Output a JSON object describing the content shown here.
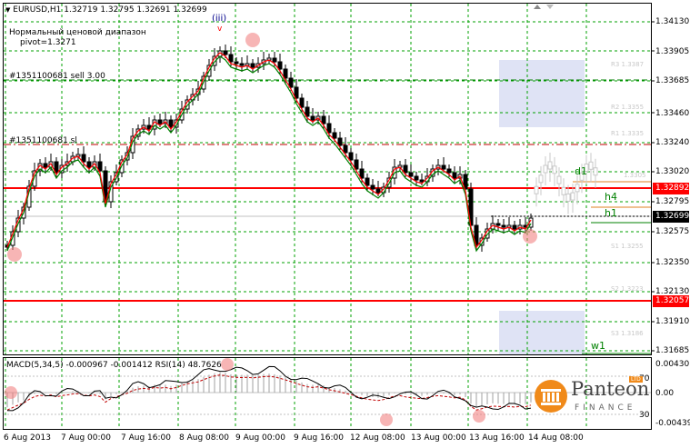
{
  "header": {
    "symbol": "EURUSD,H1",
    "ohlc": "1.32719 1.32795 1.32691 1.32699",
    "indicator_title": "Нормальный ценовой диапазон",
    "pivot": "pivot=1.3271",
    "wave_label": "(iii)",
    "wave_sub": "v"
  },
  "order_lines": {
    "sell": "#1351100681 sell 3.00",
    "sl": "#1351100681 sl"
  },
  "price_axis": [
    "1.34130",
    "1.33905",
    "1.33685",
    "1.33460",
    "1.33240",
    "1.33020",
    "1.32795",
    "1.32575",
    "1.32350",
    "1.32130",
    "1.31910",
    "1.31685"
  ],
  "price_boxes": [
    {
      "value": "1.32892",
      "color": "#ff0000"
    },
    {
      "value": "1.32699",
      "color": "#000000"
    },
    {
      "value": "1.32057",
      "color": "#ff0000"
    }
  ],
  "level_labels": {
    "r3": "R3 1.3387",
    "r2": "R2 1.3355",
    "r1": "R1 1.3335",
    "s1": "S1 1.3255",
    "s2": "S2 1.3223",
    "s3": "S3 1.3186",
    "d1": "d1",
    "h4": "h4",
    "h1": "h1",
    "w1": "w1",
    "mid": "1.3305"
  },
  "macd": {
    "title": "MACD(5,34,5) -0.000967 -0.001412",
    "rsi": "RSI(14) 48.7626",
    "axis": [
      "0.004301",
      "0.00",
      "-0.004396"
    ],
    "rsi_levels": [
      "70",
      "30"
    ]
  },
  "time_axis": [
    "6 Aug 2013",
    "7 Aug 00:00",
    "7 Aug 16:00",
    "8 Aug 08:00",
    "9 Aug 00:00",
    "9 Aug 16:00",
    "12 Aug 08:00",
    "13 Aug 00:00",
    "13 Aug 16:00",
    "14 Aug 08:00"
  ],
  "logo": {
    "name": "Panteon",
    "sub": "FINANCE",
    "badge": "LTD"
  },
  "colors": {
    "ma_fast": "#ff0000",
    "ma_slow": "#008000",
    "grid": "#00a000",
    "level_red": "#ff0000",
    "zone": "#dfe3f5",
    "candle": "#000000"
  }
}
